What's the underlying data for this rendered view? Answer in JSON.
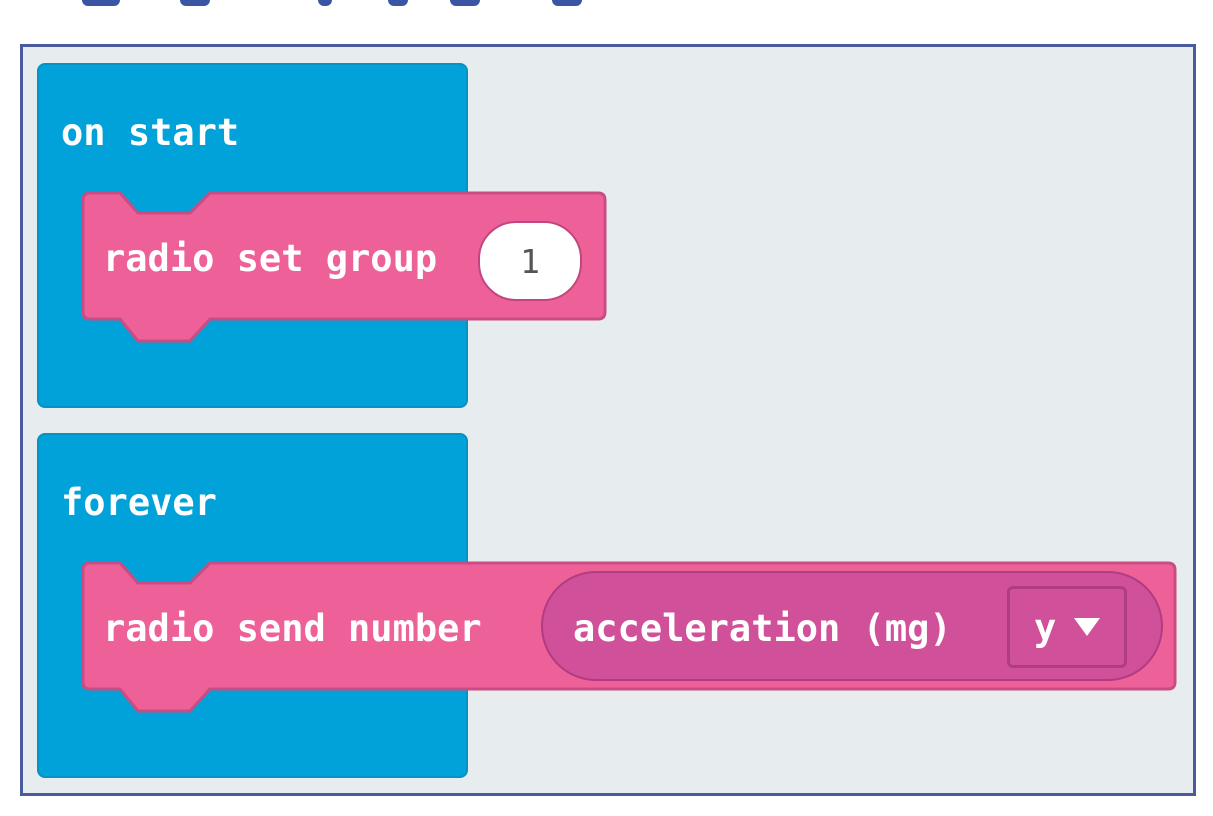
{
  "colors": {
    "workspace_bg": "#e7ecef",
    "event_block": "#00a2d9",
    "radio_block": "#ed6198",
    "input_reporter": "#d0509a",
    "frame": "#4a5a9c"
  },
  "on_start": {
    "label": "on start",
    "radio_set_group": {
      "label": "radio set group",
      "value": "1"
    }
  },
  "forever": {
    "label": "forever",
    "radio_send_number": {
      "label": "radio send number",
      "reporter": {
        "label": "acceleration (mg)",
        "dropdown_value": "y"
      }
    }
  }
}
